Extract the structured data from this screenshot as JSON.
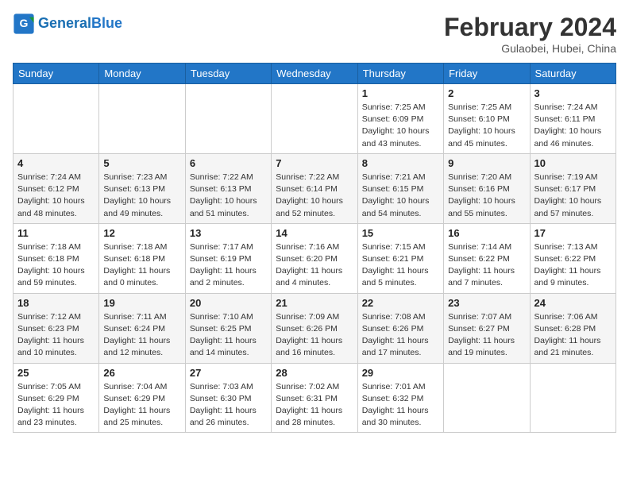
{
  "header": {
    "logo_general": "General",
    "logo_blue": "Blue",
    "month_year": "February 2024",
    "location": "Gulaobei, Hubei, China"
  },
  "weekdays": [
    "Sunday",
    "Monday",
    "Tuesday",
    "Wednesday",
    "Thursday",
    "Friday",
    "Saturday"
  ],
  "weeks": [
    [
      {
        "day": "",
        "info": ""
      },
      {
        "day": "",
        "info": ""
      },
      {
        "day": "",
        "info": ""
      },
      {
        "day": "",
        "info": ""
      },
      {
        "day": "1",
        "info": "Sunrise: 7:25 AM\nSunset: 6:09 PM\nDaylight: 10 hours\nand 43 minutes."
      },
      {
        "day": "2",
        "info": "Sunrise: 7:25 AM\nSunset: 6:10 PM\nDaylight: 10 hours\nand 45 minutes."
      },
      {
        "day": "3",
        "info": "Sunrise: 7:24 AM\nSunset: 6:11 PM\nDaylight: 10 hours\nand 46 minutes."
      }
    ],
    [
      {
        "day": "4",
        "info": "Sunrise: 7:24 AM\nSunset: 6:12 PM\nDaylight: 10 hours\nand 48 minutes."
      },
      {
        "day": "5",
        "info": "Sunrise: 7:23 AM\nSunset: 6:13 PM\nDaylight: 10 hours\nand 49 minutes."
      },
      {
        "day": "6",
        "info": "Sunrise: 7:22 AM\nSunset: 6:13 PM\nDaylight: 10 hours\nand 51 minutes."
      },
      {
        "day": "7",
        "info": "Sunrise: 7:22 AM\nSunset: 6:14 PM\nDaylight: 10 hours\nand 52 minutes."
      },
      {
        "day": "8",
        "info": "Sunrise: 7:21 AM\nSunset: 6:15 PM\nDaylight: 10 hours\nand 54 minutes."
      },
      {
        "day": "9",
        "info": "Sunrise: 7:20 AM\nSunset: 6:16 PM\nDaylight: 10 hours\nand 55 minutes."
      },
      {
        "day": "10",
        "info": "Sunrise: 7:19 AM\nSunset: 6:17 PM\nDaylight: 10 hours\nand 57 minutes."
      }
    ],
    [
      {
        "day": "11",
        "info": "Sunrise: 7:18 AM\nSunset: 6:18 PM\nDaylight: 10 hours\nand 59 minutes."
      },
      {
        "day": "12",
        "info": "Sunrise: 7:18 AM\nSunset: 6:18 PM\nDaylight: 11 hours\nand 0 minutes."
      },
      {
        "day": "13",
        "info": "Sunrise: 7:17 AM\nSunset: 6:19 PM\nDaylight: 11 hours\nand 2 minutes."
      },
      {
        "day": "14",
        "info": "Sunrise: 7:16 AM\nSunset: 6:20 PM\nDaylight: 11 hours\nand 4 minutes."
      },
      {
        "day": "15",
        "info": "Sunrise: 7:15 AM\nSunset: 6:21 PM\nDaylight: 11 hours\nand 5 minutes."
      },
      {
        "day": "16",
        "info": "Sunrise: 7:14 AM\nSunset: 6:22 PM\nDaylight: 11 hours\nand 7 minutes."
      },
      {
        "day": "17",
        "info": "Sunrise: 7:13 AM\nSunset: 6:22 PM\nDaylight: 11 hours\nand 9 minutes."
      }
    ],
    [
      {
        "day": "18",
        "info": "Sunrise: 7:12 AM\nSunset: 6:23 PM\nDaylight: 11 hours\nand 10 minutes."
      },
      {
        "day": "19",
        "info": "Sunrise: 7:11 AM\nSunset: 6:24 PM\nDaylight: 11 hours\nand 12 minutes."
      },
      {
        "day": "20",
        "info": "Sunrise: 7:10 AM\nSunset: 6:25 PM\nDaylight: 11 hours\nand 14 minutes."
      },
      {
        "day": "21",
        "info": "Sunrise: 7:09 AM\nSunset: 6:26 PM\nDaylight: 11 hours\nand 16 minutes."
      },
      {
        "day": "22",
        "info": "Sunrise: 7:08 AM\nSunset: 6:26 PM\nDaylight: 11 hours\nand 17 minutes."
      },
      {
        "day": "23",
        "info": "Sunrise: 7:07 AM\nSunset: 6:27 PM\nDaylight: 11 hours\nand 19 minutes."
      },
      {
        "day": "24",
        "info": "Sunrise: 7:06 AM\nSunset: 6:28 PM\nDaylight: 11 hours\nand 21 minutes."
      }
    ],
    [
      {
        "day": "25",
        "info": "Sunrise: 7:05 AM\nSunset: 6:29 PM\nDaylight: 11 hours\nand 23 minutes."
      },
      {
        "day": "26",
        "info": "Sunrise: 7:04 AM\nSunset: 6:29 PM\nDaylight: 11 hours\nand 25 minutes."
      },
      {
        "day": "27",
        "info": "Sunrise: 7:03 AM\nSunset: 6:30 PM\nDaylight: 11 hours\nand 26 minutes."
      },
      {
        "day": "28",
        "info": "Sunrise: 7:02 AM\nSunset: 6:31 PM\nDaylight: 11 hours\nand 28 minutes."
      },
      {
        "day": "29",
        "info": "Sunrise: 7:01 AM\nSunset: 6:32 PM\nDaylight: 11 hours\nand 30 minutes."
      },
      {
        "day": "",
        "info": ""
      },
      {
        "day": "",
        "info": ""
      }
    ]
  ]
}
